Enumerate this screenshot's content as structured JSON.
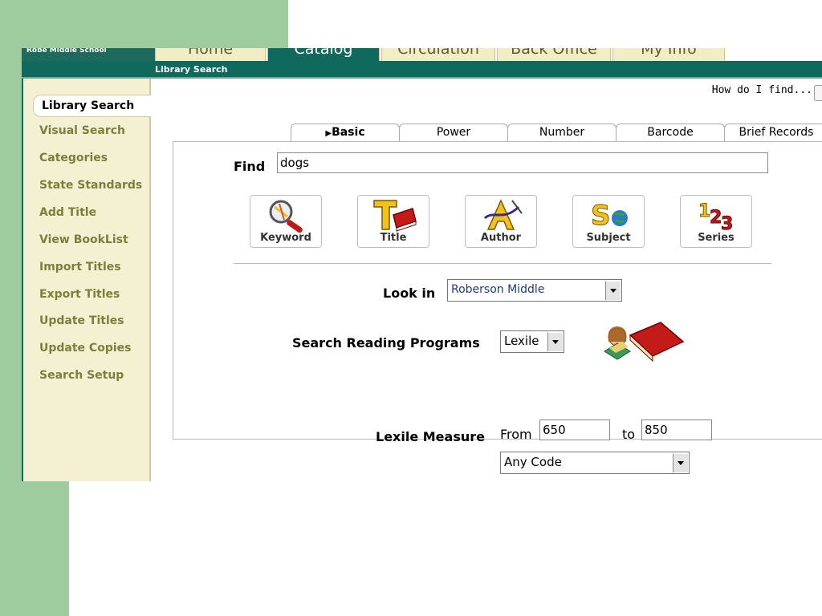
{
  "app": {
    "school_name": "Robe Middle School",
    "nav_tabs": [
      {
        "label": "Home"
      },
      {
        "label": "Catalog"
      },
      {
        "label": "Circulation"
      },
      {
        "label": "Back Office"
      },
      {
        "label": "My Info"
      }
    ],
    "breadcrumb": "Library Search",
    "help_link": "How do I find..."
  },
  "sidebar": {
    "active": "Library Search",
    "items": [
      {
        "label": "Visual Search"
      },
      {
        "label": "Categories"
      },
      {
        "label": "State Standards"
      },
      {
        "label": "Add Title"
      },
      {
        "label": "View BookList"
      },
      {
        "label": "Import Titles"
      },
      {
        "label": "Export Titles"
      },
      {
        "label": "Update Titles"
      },
      {
        "label": "Update Copies"
      },
      {
        "label": "Search Setup"
      }
    ]
  },
  "search": {
    "tabs": [
      {
        "label": "Basic"
      },
      {
        "label": "Power"
      },
      {
        "label": "Number"
      },
      {
        "label": "Barcode"
      },
      {
        "label": "Brief Records"
      }
    ],
    "active_tab_marker": "▶",
    "find_label": "Find",
    "find_value": "dogs",
    "type_buttons": [
      {
        "label": "Keyword",
        "icon": "keyword-icon"
      },
      {
        "label": "Title",
        "icon": "title-icon"
      },
      {
        "label": "Author",
        "icon": "author-icon"
      },
      {
        "label": "Subject",
        "icon": "subject-icon"
      },
      {
        "label": "Series",
        "icon": "series-icon"
      }
    ],
    "look_in_label": "Look in",
    "look_in_value": "Roberson Middle",
    "reading_programs_label": "Search Reading Programs",
    "reading_program_value": "Lexile",
    "lexile_label": "Lexile Measure",
    "from_label": "From",
    "from_value": "650",
    "to_label": "to",
    "to_value": "850",
    "code_value": "Any Code"
  },
  "colors": {
    "teal": "#0f6a5d",
    "sidebar_bg": "#f4f1d2",
    "sidebar_text": "#7b7f3c",
    "slide_green": "#9fcc9f"
  }
}
